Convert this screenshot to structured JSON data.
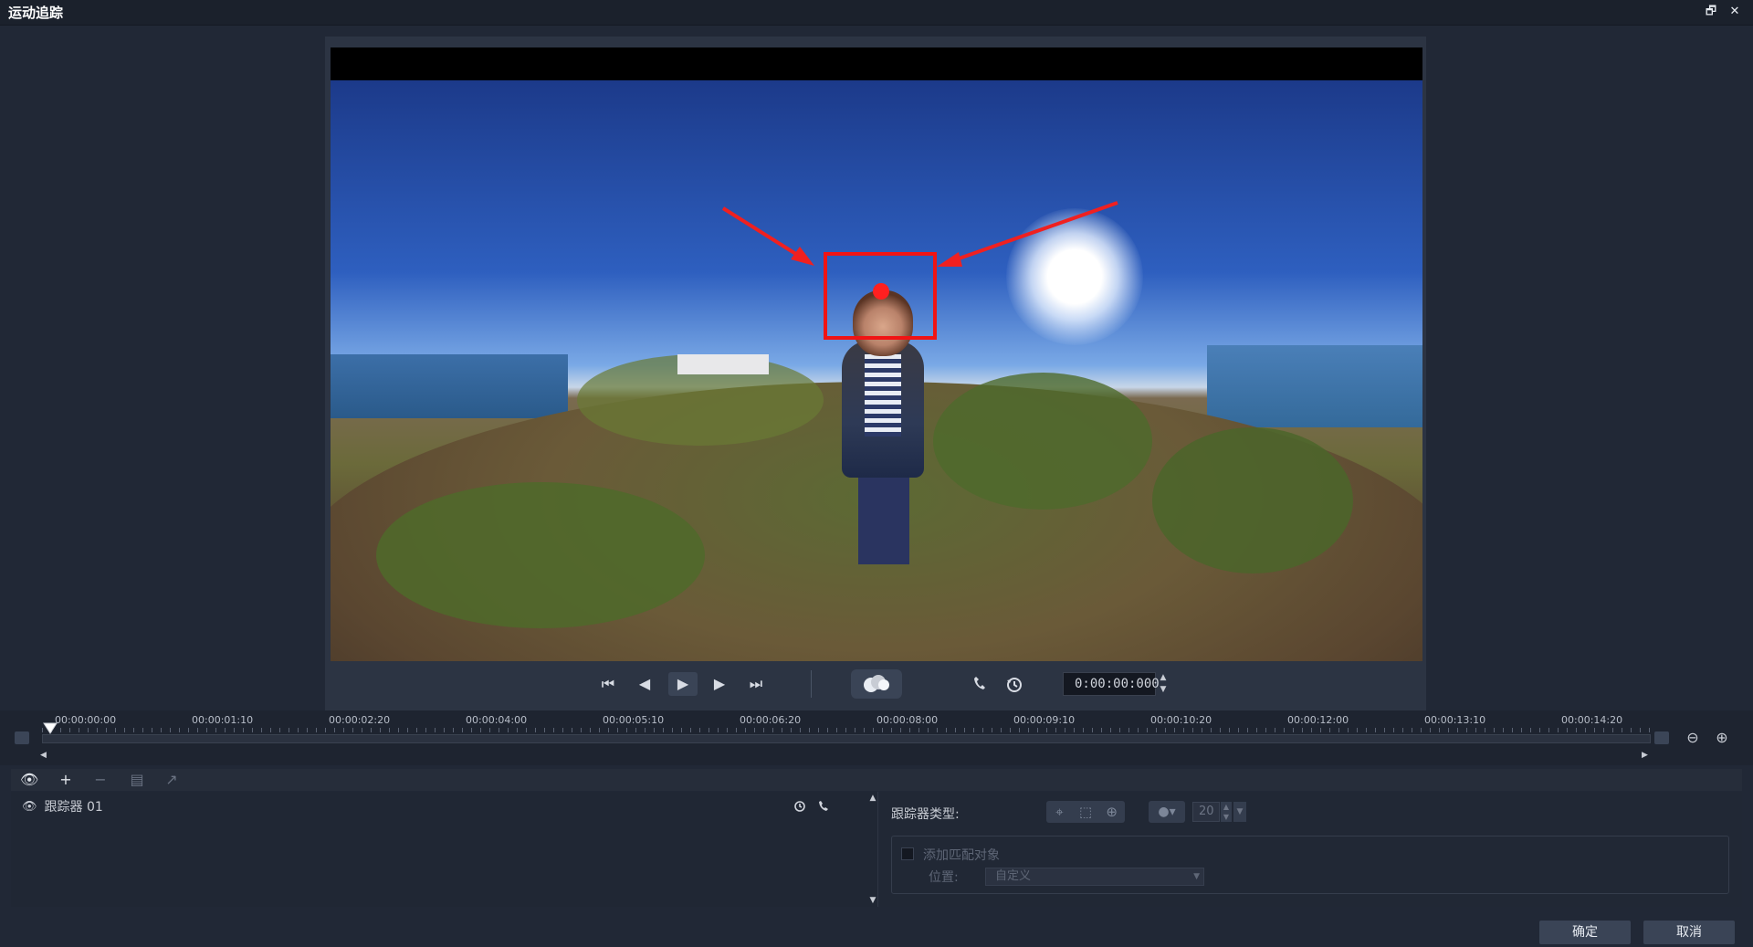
{
  "window": {
    "title": "运动追踪",
    "restore_icon": "restore-window-icon",
    "close_icon": "close-icon",
    "restore_glyph": "🗗",
    "close_glyph": "✕"
  },
  "controls": {
    "start_glyph": "⏮",
    "prev_frame_glyph": "◀",
    "play_glyph": "▶",
    "next_frame_glyph": "▶",
    "end_glyph": "⏭",
    "timecode": "0:00:00:000"
  },
  "timeline": {
    "tick_labels": [
      "00:00:00:00",
      "00:00:01:10",
      "00:00:02:20",
      "00:00:04:00",
      "00:00:05:10",
      "00:00:06:20",
      "00:00:08:00",
      "00:00:09:10",
      "00:00:10:20",
      "00:00:12:00",
      "00:00:13:10",
      "00:00:14:20"
    ],
    "zoom_out_glyph": "⊖",
    "zoom_in_glyph": "⊕"
  },
  "toolbar": {
    "eye_glyph": "👁",
    "add_glyph": "+",
    "remove_glyph": "−",
    "rename_glyph": "▤",
    "export_glyph": "↗"
  },
  "trackers": [
    {
      "name": "跟踪器 01"
    }
  ],
  "properties": {
    "tracker_type_label": "跟踪器类型:",
    "size_value": "20",
    "add_match_label": "添加匹配对象",
    "position_label": "位置:",
    "position_value": "自定义"
  },
  "footer": {
    "ok_label": "确定",
    "cancel_label": "取消"
  },
  "colors": {
    "accent_red": "#f01414",
    "background": "#212836"
  }
}
